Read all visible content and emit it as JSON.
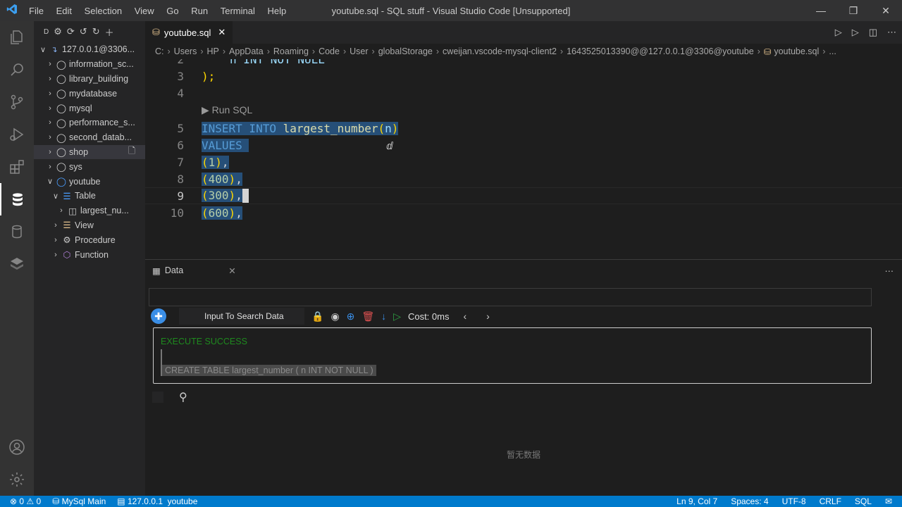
{
  "titlebar": {
    "menus": [
      "File",
      "Edit",
      "Selection",
      "View",
      "Go",
      "Run",
      "Terminal",
      "Help"
    ],
    "title": "youtube.sql - SQL stuff - Visual Studio Code [Unsupported]"
  },
  "sidebar": {
    "connection": "127.0.0.1@3306...",
    "databases": [
      "information_sc...",
      "library_building",
      "mydatabase",
      "mysql",
      "performance_s...",
      "second_datab...",
      "shop",
      "sys",
      "youtube"
    ],
    "youtube_children": {
      "table": "Table",
      "table_item": "largest_nu...",
      "view": "View",
      "procedure": "Procedure",
      "function": "Function"
    }
  },
  "editor": {
    "tab_label": "youtube.sql",
    "breadcrumb": [
      "C:",
      "Users",
      "HP",
      "AppData",
      "Roaming",
      "Code",
      "User",
      "globalStorage",
      "cweijan.vscode-mysql-client2",
      "1643525013390@@127.0.0.1@3306@youtube",
      "youtube.sql",
      "..."
    ],
    "partial_line2": "n INT NOT NULL",
    "lines": {
      "l3": ");",
      "codelens": "Run SQL",
      "l5_kw": "INSERT INTO",
      "l5_fn": "largest_number",
      "l5_arg": "n",
      "l6": "VALUES",
      "l7_val": "1",
      "l8_val": "400",
      "l9_val": "300",
      "l10_val": "600"
    },
    "line_numbers": [
      "2",
      "3",
      "4",
      "5",
      "6",
      "7",
      "8",
      "9",
      "10"
    ]
  },
  "panel": {
    "tab_label": "Data",
    "search_placeholder": "Input To Search Data",
    "cost": "Cost: 0ms",
    "message_status": "EXECUTE SUCCESS",
    "message_sql": "CREATE TABLE largest_number ( n INT NOT NULL )",
    "empty_text": "暂无数据"
  },
  "statusbar": {
    "errors": "0",
    "warnings": "0",
    "mysql_main": "MySql Main",
    "connection": "127.0.0.1",
    "database": "youtube",
    "position": "Ln 9, Col 7",
    "spaces": "Spaces: 4",
    "encoding": "UTF-8",
    "eol": "CRLF",
    "language": "SQL"
  }
}
